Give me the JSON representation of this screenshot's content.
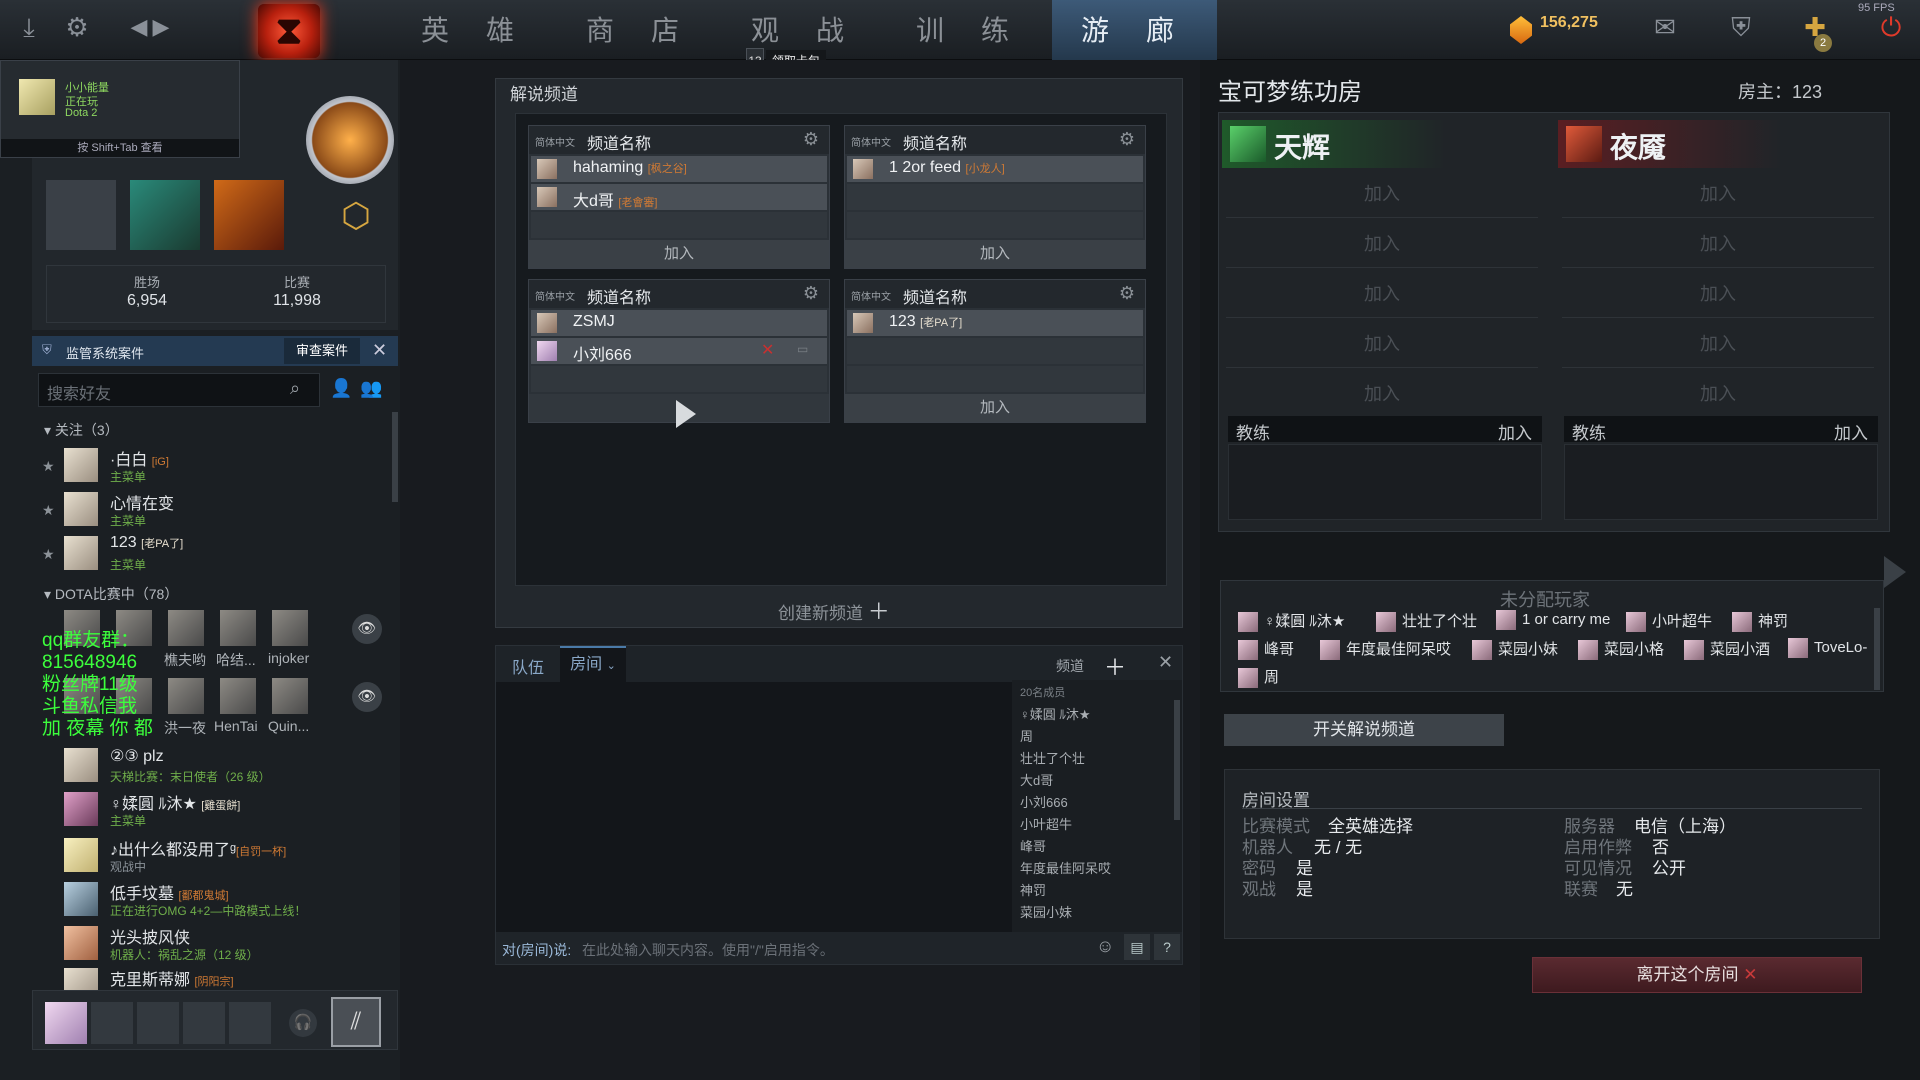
{
  "topbar": {
    "tabs": [
      "英 雄",
      "商 店",
      "观 战",
      "训 练",
      "游 廊"
    ],
    "active_tab": 4,
    "coins": "156,275",
    "fps": "95 FPS",
    "badge": "13",
    "claim_card": "领取卡包",
    "plus_count": "2"
  },
  "notification": {
    "name": "小小能量",
    "status": "正在玩",
    "game": "Dota 2",
    "hint": "按 Shift+Tab 查看"
  },
  "profile": {
    "wins_label": "胜场",
    "wins": "6,954",
    "matches_label": "比赛",
    "matches": "11,998"
  },
  "report": {
    "title": "监管系统案件",
    "button": "审查案件"
  },
  "friends": {
    "search_placeholder": "搜索好友",
    "following_header": "关注（3）",
    "following": [
      {
        "name": "·白白",
        "tag": "[iG]",
        "sub": "主菜单"
      },
      {
        "name": "心情在变",
        "tag": "",
        "sub": "主菜单"
      },
      {
        "name": "123",
        "tag": "[老PA了]",
        "sub": "主菜单"
      }
    ],
    "ingame_header": "DOTA比赛中（78）",
    "ingame_row1": [
      "",
      "",
      "樵夫哟",
      "哈结...",
      "injoker"
    ],
    "ingame_row2": [
      "",
      "",
      "洪一夜",
      "HenTai",
      "Quin..."
    ],
    "others": [
      {
        "name": "②③ plz",
        "tag": "",
        "sub": "天梯比赛：末日使者（26 级）"
      },
      {
        "name": "♀媃圓 ﾙ沐★",
        "tag": "[雞蛋餅]",
        "sub": "主菜单"
      },
      {
        "name": "♪出什么都没用了ᵍ",
        "tag": "[自罚一杯]",
        "sub": "观战中"
      },
      {
        "name": "低手坟墓",
        "tag": "[鄱都鬼城]",
        "sub": "正在进行OMG 4+2—中路模式上线！"
      },
      {
        "name": "光头披风侠",
        "tag": "",
        "sub": "机器人：祸乱之源（12 级）"
      },
      {
        "name": "克里斯蒂娜",
        "tag": "[阴阳宗]",
        "sub": ""
      }
    ]
  },
  "overlay_text": "qq群友群：\n815648946\n粉丝牌11级\n斗鱼私信我\n加 夜幕 你 都",
  "center": {
    "title": "解说频道",
    "create": "创建新频道",
    "channels": [
      {
        "lang": "简体中文",
        "name": "频道名称",
        "join": "加入",
        "members": [
          {
            "name": "hahaming",
            "tag": "[枫之谷]"
          },
          {
            "name": "大d哥",
            "tag": "[老會審]"
          }
        ]
      },
      {
        "lang": "简体中文",
        "name": "频道名称",
        "join": "加入",
        "members": [
          {
            "name": "1 2or feed",
            "tag": "[小龙人]"
          }
        ]
      },
      {
        "lang": "简体中文",
        "name": "频道名称",
        "join": "",
        "members": [
          {
            "name": "ZSMJ",
            "tag": ""
          },
          {
            "name": "小刘666",
            "tag": ""
          }
        ]
      },
      {
        "lang": "简体中文",
        "name": "频道名称",
        "join": "加入",
        "members": [
          {
            "name": "123",
            "tag": "[老PA了]"
          }
        ]
      }
    ]
  },
  "chat": {
    "tab_team": "队伍",
    "tab_room": "房间",
    "channel_label": "频道",
    "member_count": "20名成员",
    "members": [
      "♀媃圓 ﾙ沐★",
      "周",
      "壮壮了个壮",
      "大d哥",
      "小刘666",
      "小叶超牛",
      "峰哥",
      "年度最佳阿呆哎",
      "神罚",
      "菜园小妹"
    ],
    "input_label": "对(房间)说:",
    "input_placeholder": "在此处输入聊天内容。使用\"/\"启用指令。"
  },
  "lobby": {
    "title": "宝可梦练功房",
    "host": "房主：123",
    "radiant": "天辉",
    "dire": "夜魇",
    "join": "加入",
    "coach": "教练",
    "unassigned_title": "未分配玩家",
    "unassigned_row1": [
      "♀媃圓 ﾙ沐★",
      "壮壮了个壮",
      "1 or carry me",
      "小叶超牛",
      "神罚"
    ],
    "unassigned_row2": [
      "峰哥",
      "年度最佳阿呆哎",
      "菜园小妹",
      "菜园小格",
      "菜园小酒",
      "ToveLo-"
    ],
    "unassigned_row3": [
      "周"
    ],
    "commentary_toggle": "开关解说频道",
    "settings_title": "房间设置",
    "settings": [
      {
        "k": "比赛模式",
        "v": "全英雄选择"
      },
      {
        "k": "机器人",
        "v": "无 / 无"
      },
      {
        "k": "密码",
        "v": "是"
      },
      {
        "k": "观战",
        "v": "是"
      }
    ],
    "settings_right": [
      {
        "k": "服务器",
        "v": "电信（上海）"
      },
      {
        "k": "启用作弊",
        "v": "否"
      },
      {
        "k": "可见情况",
        "v": "公开"
      },
      {
        "k": "联赛",
        "v": "无"
      }
    ],
    "leave": "离开这个房间"
  },
  "colors": {
    "accent_blue": "#3d5a78",
    "radiant": "#2f8a3a",
    "dire": "#8a2a2a",
    "gold": "#f0c060"
  }
}
